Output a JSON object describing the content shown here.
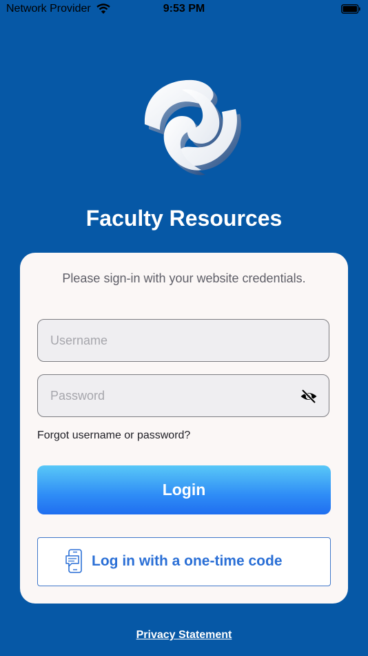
{
  "status_bar": {
    "carrier": "Network Provider",
    "time": "9:53 PM"
  },
  "app": {
    "title": "Faculty Resources"
  },
  "login_card": {
    "subtitle": "Please sign-in with your website credentials.",
    "username_placeholder": "Username",
    "password_placeholder": "Password",
    "forgot_label": "Forgot username or password?",
    "login_label": "Login",
    "otp_label": "Log in with a one-time code"
  },
  "footer": {
    "privacy_label": "Privacy Statement"
  },
  "icons": {
    "wifi": "wifi-icon",
    "battery": "battery-icon",
    "logo": "app-logo",
    "eye": "eye-slash-icon",
    "otp": "phone-message-icon"
  },
  "colors": {
    "background": "#0658a6",
    "card": "#fbf7f6",
    "accent": "#2a6fd6"
  }
}
